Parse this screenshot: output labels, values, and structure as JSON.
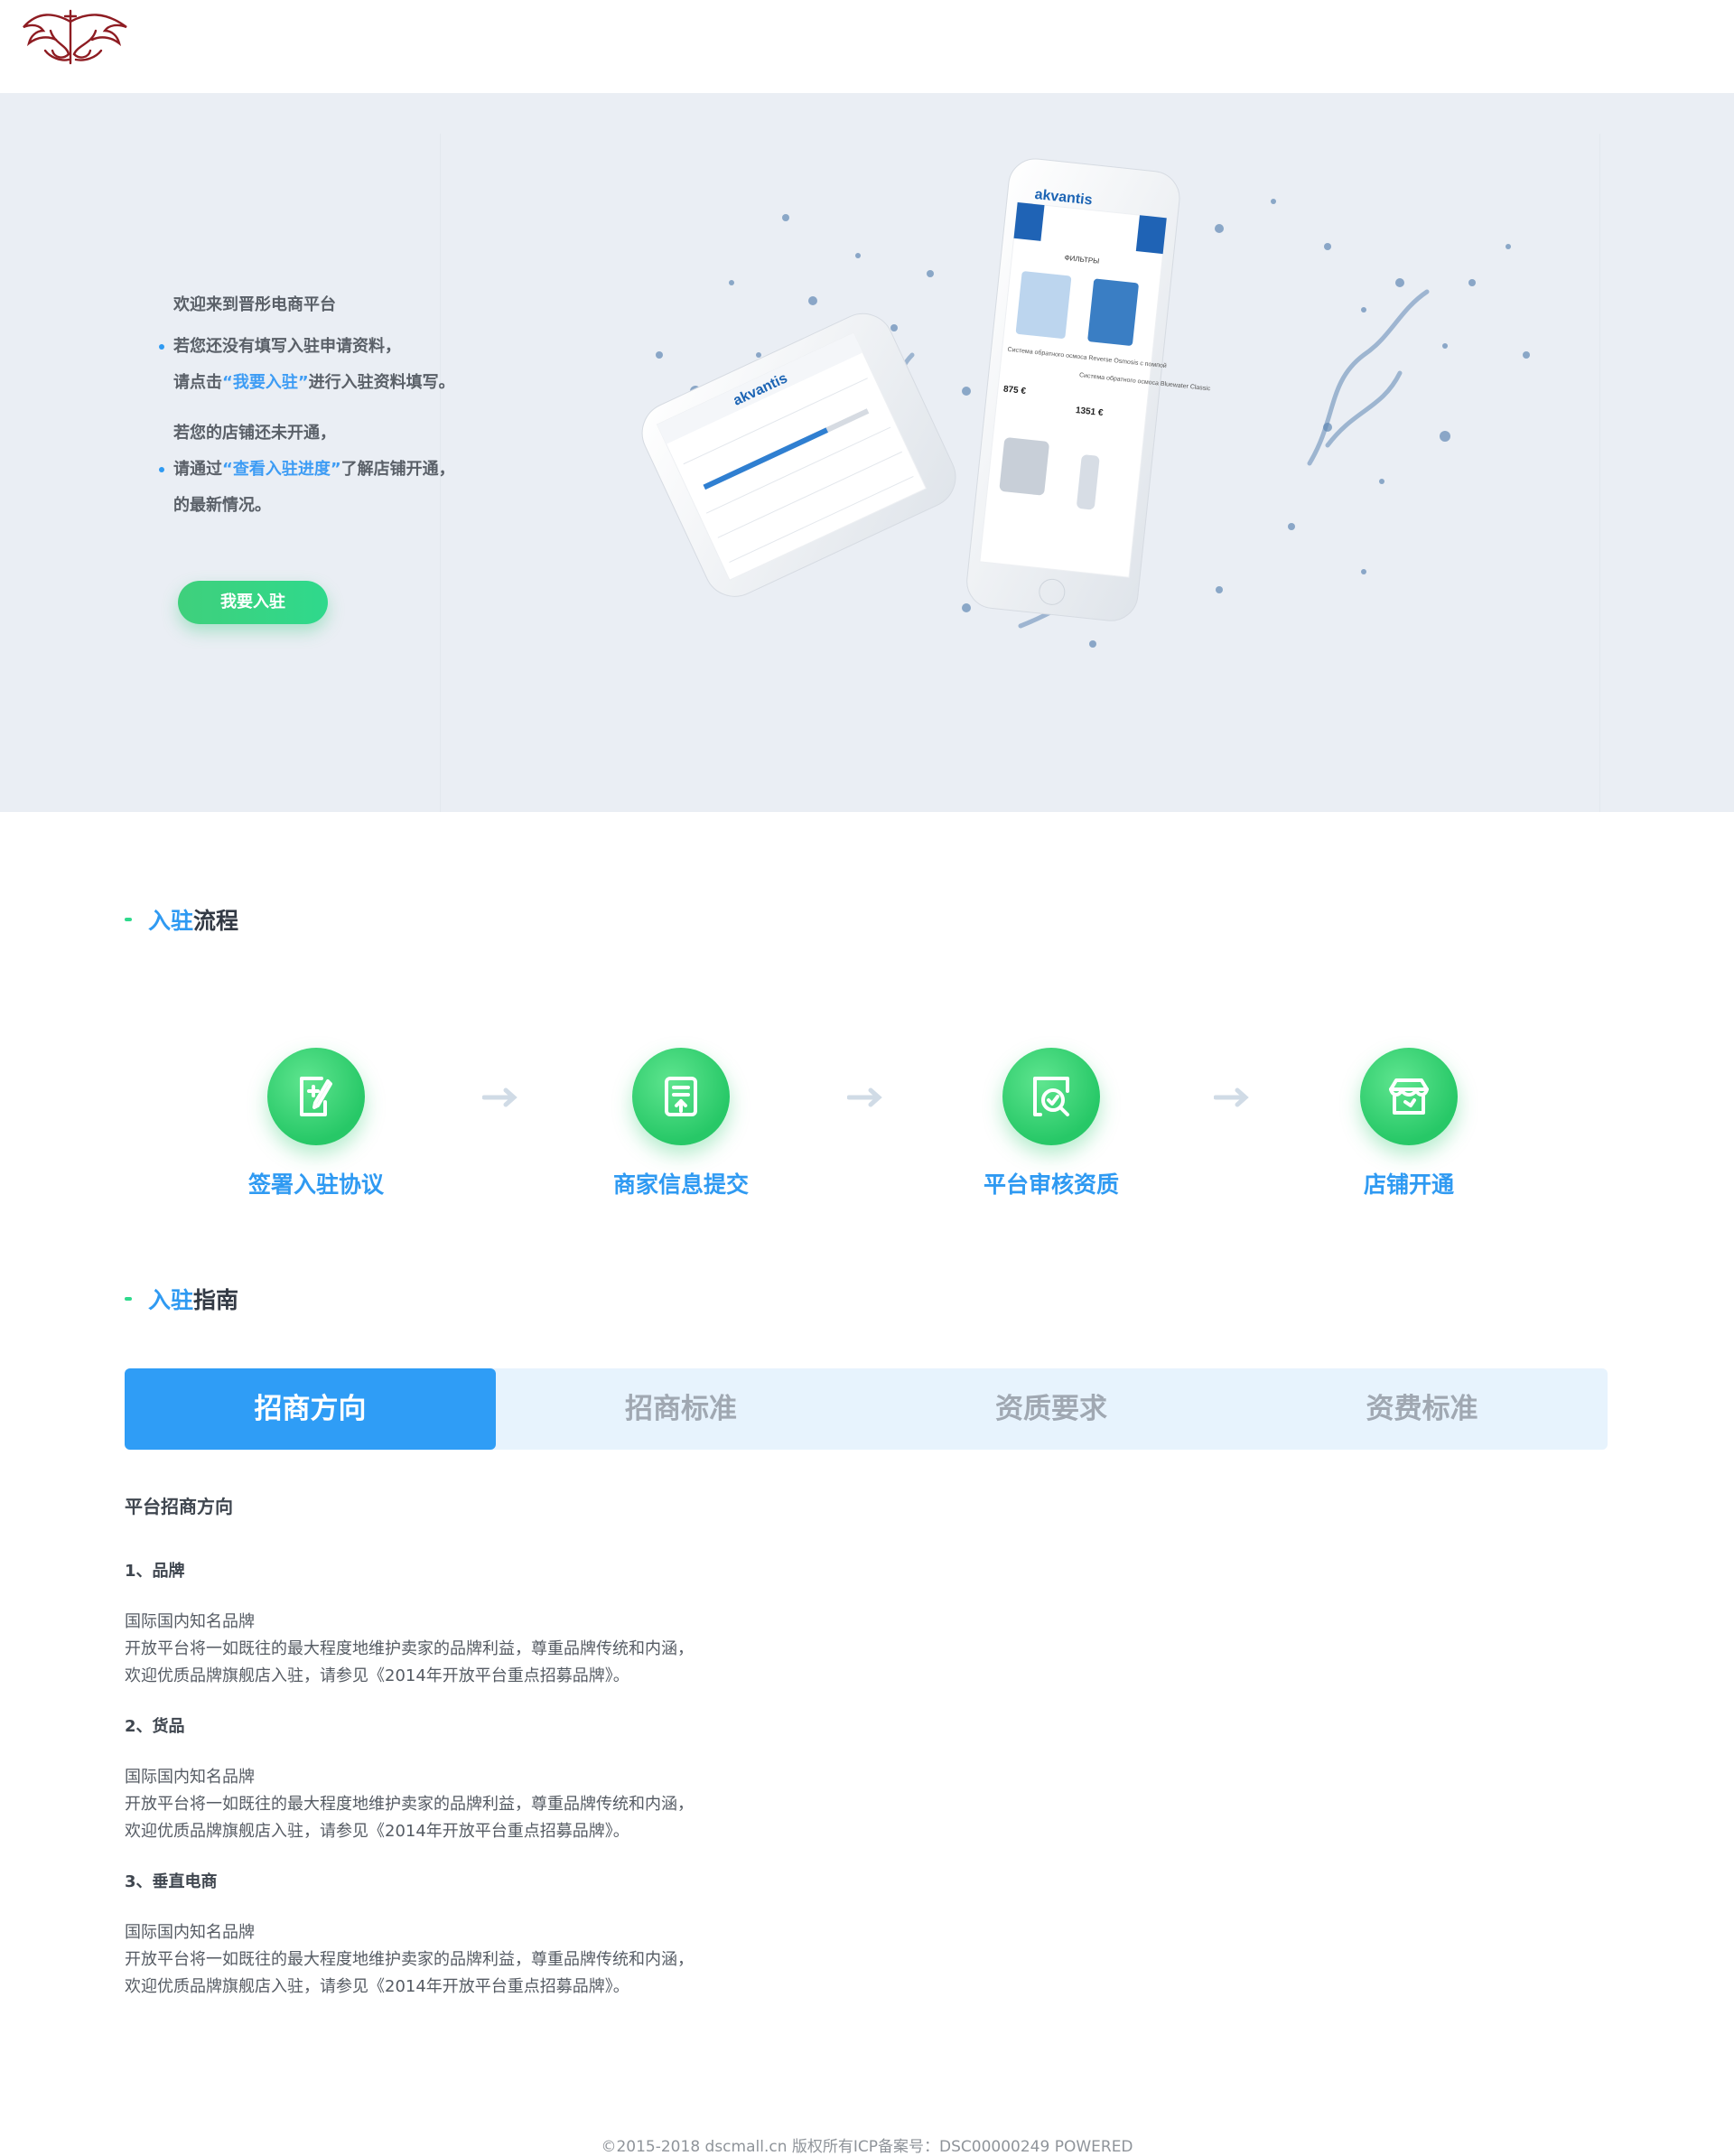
{
  "hero": {
    "welcome": "欢迎来到晋彤电商平台",
    "line1": "若您还没有填写入驻申请资料，",
    "line2_prefix": "请点击",
    "line2_link": "“我要入驻”",
    "line2_suffix": "进行入驻资料填写。",
    "line3": "若您的店铺还未开通，",
    "line4_prefix": "请通过",
    "line4_link": "“查看入驻进度”",
    "line4_suffix": "了解店铺开通，",
    "line5": "的最新情况。",
    "button": "我要入驻",
    "mock_brand": "akvantis",
    "mock_filter_title": "ФИЛЬТРЫ",
    "mock_item1_name": "Система обратного осмоса Reverse Osmosis с помпой",
    "mock_item1_price": "875 €",
    "mock_item2_name": "Система обратного осмоса Bluewater Classic",
    "mock_item2_price": "1351 €"
  },
  "process": {
    "title_blue": "入驻",
    "title_rest": "流程",
    "steps": [
      {
        "label": "签署入驻协议",
        "icon": "sign-agreement-icon"
      },
      {
        "label": "商家信息提交",
        "icon": "submit-info-icon"
      },
      {
        "label": "平台审核资质",
        "icon": "review-icon"
      },
      {
        "label": "店铺开通",
        "icon": "store-icon"
      }
    ]
  },
  "guide": {
    "title_blue": "入驻",
    "title_rest": "指南",
    "tabs": [
      "招商方向",
      "招商标准",
      "资质要求",
      "资费标准"
    ],
    "active_tab": 0
  },
  "content": {
    "heading": "平台招商方向",
    "sections": [
      {
        "title": "1、品牌",
        "lines": [
          "国际国内知名品牌",
          "开放平台将一如既往的最大程度地维护卖家的品牌利益，尊重品牌传统和内涵，",
          "欢迎优质品牌旗舰店入驻，请参见《2014年开放平台重点招募品牌》。"
        ]
      },
      {
        "title": "2、货品",
        "lines": [
          "国际国内知名品牌",
          "开放平台将一如既往的最大程度地维护卖家的品牌利益，尊重品牌传统和内涵，",
          "欢迎优质品牌旗舰店入驻，请参见《2014年开放平台重点招募品牌》。"
        ]
      },
      {
        "title": "3、垂直电商",
        "lines": [
          "国际国内知名品牌",
          "开放平台将一如既往的最大程度地维护卖家的品牌利益，尊重品牌传统和内涵，",
          "欢迎优质品牌旗舰店入驻，请参见《2014年开放平台重点招募品牌》。"
        ]
      }
    ]
  },
  "footer": {
    "text": "©2015-2018 dscmall.cn   版权所有ICP备案号：DSC00000249 POWERED"
  },
  "colors": {
    "accent_blue": "#2f9af2",
    "accent_green": "#2fd98c",
    "hero_bg": "#eaeef4",
    "tab_bg": "#e7f3fd"
  }
}
